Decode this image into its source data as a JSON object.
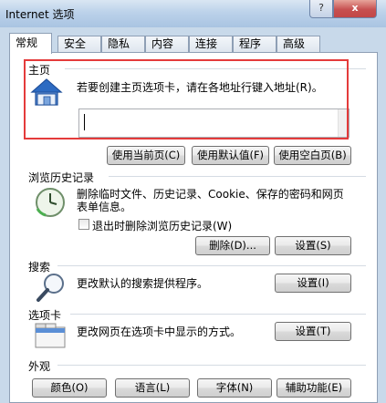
{
  "window": {
    "title": "Internet 选项",
    "help_label": "?",
    "close_label": "x"
  },
  "tabs": [
    "常规",
    "安全",
    "隐私",
    "内容",
    "连接",
    "程序",
    "高级"
  ],
  "home": {
    "heading": "主页",
    "description": "若要创建主页选项卡，请在各地址行键入地址(R)。",
    "url_value": "",
    "buttons": {
      "use_current": "使用当前页(C)",
      "use_default": "使用默认值(F)",
      "use_blank": "使用空白页(B)"
    }
  },
  "history": {
    "heading": "浏览历史记录",
    "description_line1": "删除临时文件、历史记录、Cookie、保存的密码和网页",
    "description_line2": "表单信息。",
    "checkbox_label": "退出时删除浏览历史记录(W)",
    "checkbox_checked": false,
    "delete_button": "删除(D)...",
    "settings_button": "设置(S)"
  },
  "search": {
    "heading": "搜索",
    "description": "更改默认的搜索提供程序。",
    "settings_button": "设置(I)"
  },
  "tabs_section": {
    "heading": "选项卡",
    "description": "更改网页在选项卡中显示的方式。",
    "settings_button": "设置(T)"
  },
  "appearance": {
    "heading": "外观",
    "buttons": {
      "colors": "颜色(O)",
      "languages": "语言(L)",
      "fonts": "字体(N)",
      "accessibility": "辅助功能(E)"
    }
  },
  "colors": {
    "highlight": "#e43b3b",
    "titlebar": "#bcd2ea"
  }
}
